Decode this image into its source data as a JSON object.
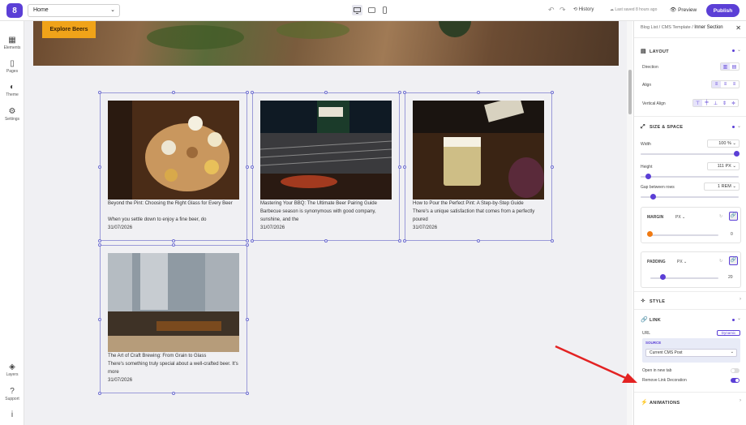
{
  "topbar": {
    "logo": "8",
    "page_select": "Home",
    "history": "History",
    "saved": "Last saved 8 hours ago",
    "preview": "Preview",
    "publish": "Publish"
  },
  "leftbar": {
    "elements": "Elements",
    "pages": "Pages",
    "theme": "Theme",
    "settings": "Settings",
    "layers": "Layers",
    "support": "Support",
    "info": "i"
  },
  "canvas": {
    "explore_label": "Explore Beers",
    "cards": [
      {
        "title": "Beyond the Pint: Choosing the Right Glass for Every Beer",
        "excerpt": "When you settle down to enjoy a fine beer, do",
        "date": "31/07/2026"
      },
      {
        "title": "Mastering Your BBQ: The Ultimate Beer Pairing Guide",
        "excerpt": "Barbecue season is synonymous with good company, sunshine, and the",
        "date": "31/07/2026"
      },
      {
        "title": "How to Pour the Perfect Pint: A Step-by-Step Guide",
        "excerpt": "There's a unique satisfaction that comes from a perfectly poured",
        "date": "31/07/2026"
      },
      {
        "title": "The Art of Craft Brewing: From Grain to Glass",
        "excerpt": "There's something truly special about a well-crafted beer. It's more",
        "date": "31/07/2026"
      }
    ]
  },
  "panel": {
    "crumb1": "Blog List",
    "crumb2": "CMS Template",
    "crumb3": "Inner Section",
    "layout": "LAYOUT",
    "direction": "Direction",
    "align": "Align",
    "valign": "Vertical Align",
    "size_space": "SIZE & SPACE",
    "width": "Width",
    "width_val": "100",
    "width_unit": "%",
    "height": "Height",
    "height_val": "111",
    "height_unit": "PX",
    "gap": "Gap between rows",
    "gap_val": "1",
    "gap_unit": "REM",
    "margin": "MARGIN",
    "margin_unit": "PX",
    "margin_val": "0",
    "padding": "PADDING",
    "padding_unit": "PX",
    "padding_val": "20",
    "style": "STYLE",
    "link": "LINK",
    "url": "URL",
    "dynamic": "Dynamic",
    "source": "SOURCE",
    "source_val": "Current CMS Post",
    "open_new_tab": "Open in new tab",
    "remove_deco": "Remove Link Decoration",
    "animations": "ANIMATIONS",
    "width_level": 1.0,
    "height_level": 0.05,
    "gap_level": 0.1,
    "margin_level": 0.0,
    "padding_level": 0.2
  },
  "colors": {
    "accent": "#5b3fd6",
    "cta": "#f0a319",
    "arrow": "#e32222"
  }
}
